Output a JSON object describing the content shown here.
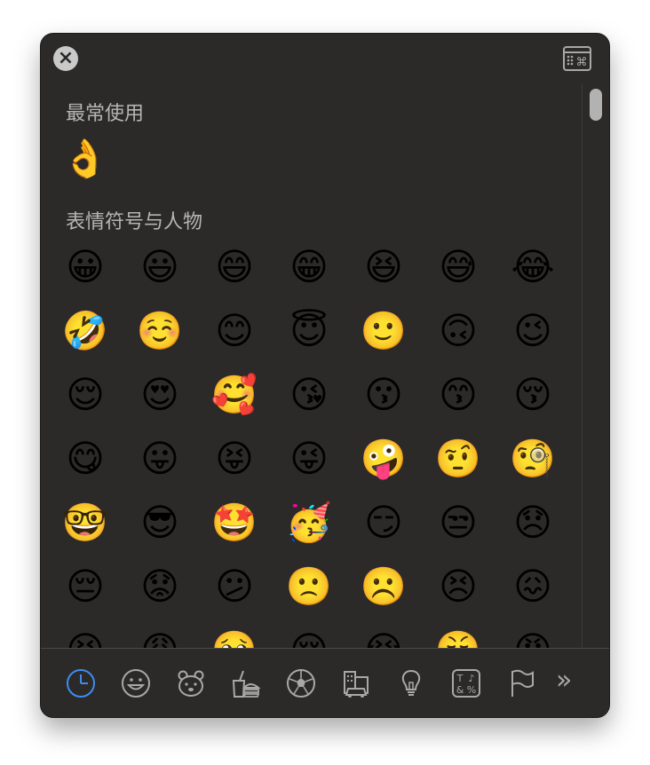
{
  "window": {
    "close_label": "×"
  },
  "sections": {
    "frequent": {
      "title": "最常使用",
      "emojis": [
        "👌"
      ]
    },
    "smileys": {
      "title": "表情符号与人物",
      "emojis": [
        "😀",
        "😃",
        "😄",
        "😁",
        "😆",
        "😅",
        "😂",
        "🤣",
        "☺️",
        "😊",
        "😇",
        "🙂",
        "🙃",
        "😉",
        "😌",
        "😍",
        "🥰",
        "😘",
        "😗",
        "😙",
        "😚",
        "😋",
        "😛",
        "😝",
        "😜",
        "🤪",
        "🤨",
        "🧐",
        "🤓",
        "😎",
        "🤩",
        "🥳",
        "😏",
        "😒",
        "😞",
        "😔",
        "😟",
        "😕",
        "🙁",
        "☹️",
        "😣",
        "😖",
        "😫",
        "😩",
        "🥺",
        "😢",
        "😭",
        "😤",
        "😠"
      ]
    }
  },
  "bottom_bar": {
    "categories": [
      {
        "icon": "clock-icon",
        "active": true
      },
      {
        "icon": "smiley-icon",
        "active": false
      },
      {
        "icon": "animal-icon",
        "active": false
      },
      {
        "icon": "food-icon",
        "active": false
      },
      {
        "icon": "soccer-ball-icon",
        "active": false
      },
      {
        "icon": "buildings-car-icon",
        "active": false
      },
      {
        "icon": "lightbulb-icon",
        "active": false
      },
      {
        "icon": "symbols-icon",
        "active": false
      },
      {
        "icon": "flag-icon",
        "active": false
      }
    ],
    "more_label": "»"
  },
  "colors": {
    "panel_bg": "#2b2a29",
    "active_accent": "#3f8cf0",
    "icon_gray": "#a9a8a7",
    "title_text": "#b7b5b3"
  }
}
